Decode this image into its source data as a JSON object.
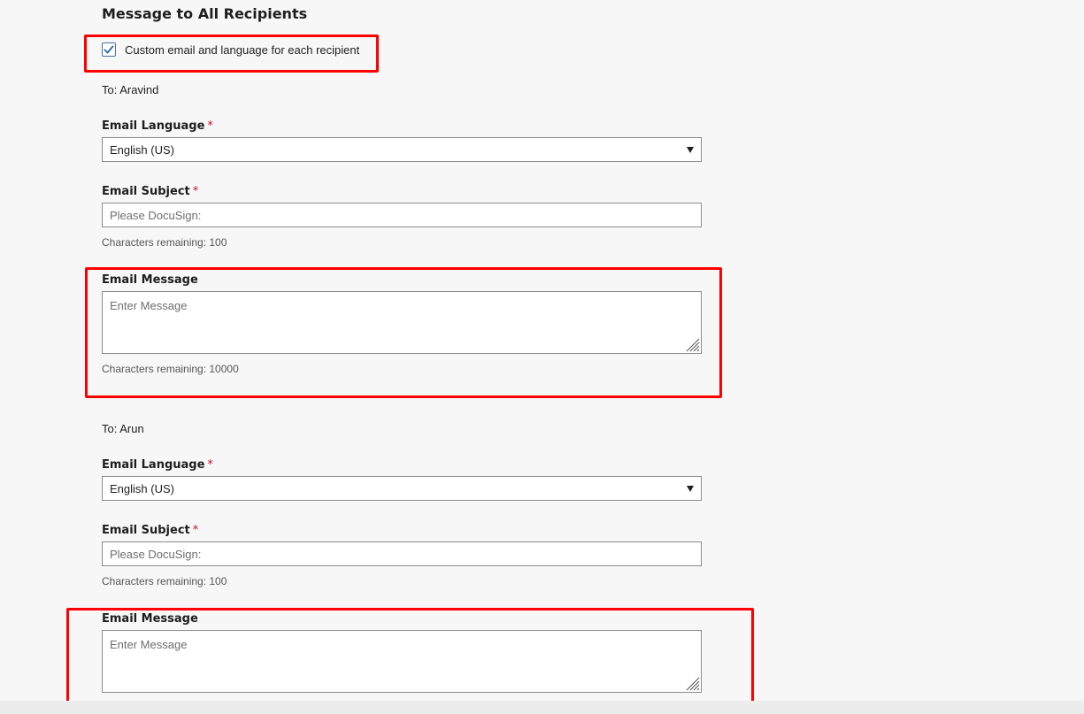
{
  "section": {
    "title": "Message to All Recipients",
    "custom_checkbox": {
      "label": "Custom email and language for each recipient",
      "checked": true
    }
  },
  "recipients": [
    {
      "to_label": "To: Aravind",
      "language_label": "Email Language",
      "language_value": "English (US)",
      "subject_label": "Email Subject",
      "subject_placeholder": "Please DocuSign:",
      "subject_remaining": "Characters remaining: 100",
      "message_label": "Email Message",
      "message_placeholder": "Enter Message",
      "message_remaining": "Characters remaining: 10000"
    },
    {
      "to_label": "To: Arun",
      "language_label": "Email Language",
      "language_value": "English (US)",
      "subject_label": "Email Subject",
      "subject_placeholder": "Please DocuSign:",
      "subject_remaining": "Characters remaining: 100",
      "message_label": "Email Message",
      "message_placeholder": "Enter Message"
    }
  ],
  "required_marker": "*",
  "colors": {
    "highlight": "#ff0000",
    "required": "#c8102e",
    "checkbox_check": "#2463a8",
    "background": "#f7f7f7"
  }
}
